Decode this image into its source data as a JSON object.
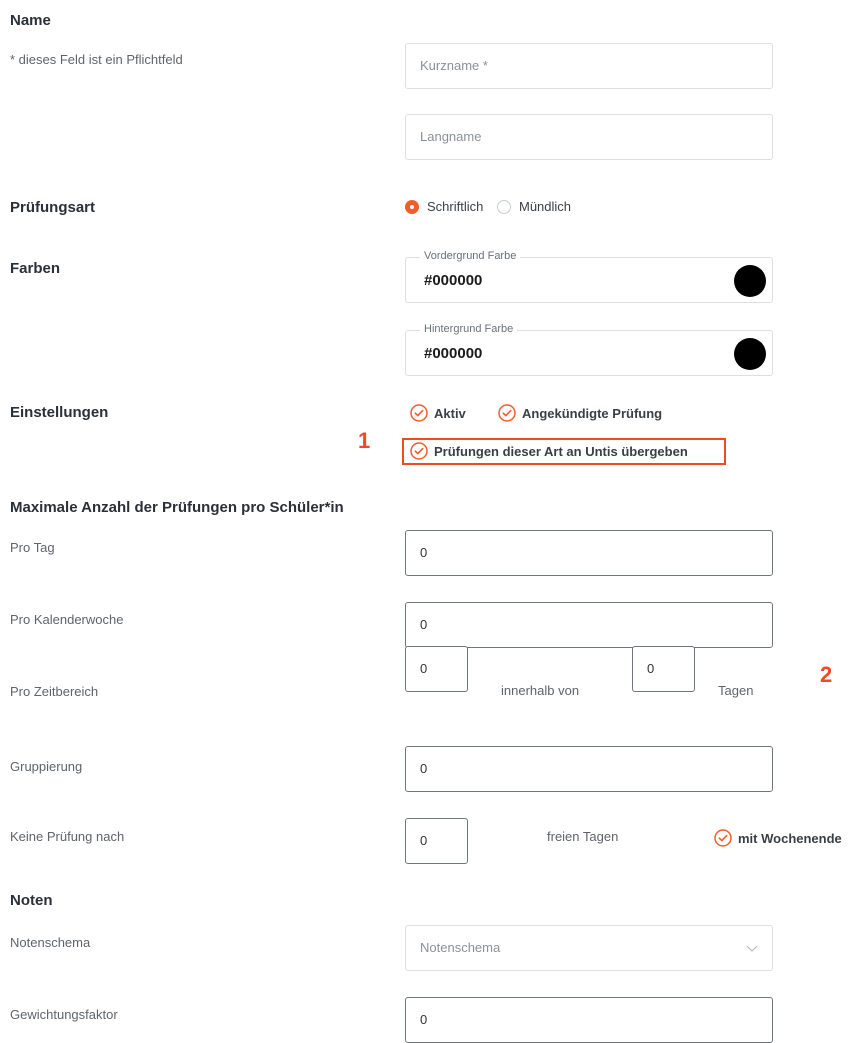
{
  "sections": {
    "name": "Name",
    "pruefungsart": "Prüfungsart",
    "farben": "Farben",
    "einstellungen": "Einstellungen",
    "maximale": "Maximale Anzahl der Prüfungen pro Schüler*in",
    "noten": "Noten"
  },
  "name": {
    "hint": "* dieses Feld ist ein Pflichtfeld",
    "kurzname_placeholder": "Kurzname *",
    "langname_placeholder": "Langname"
  },
  "pruefungsart": {
    "options": [
      "Schriftlich",
      "Mündlich"
    ],
    "selected": "Schriftlich"
  },
  "farben": {
    "vordergrund_label": "Vordergrund Farbe",
    "vordergrund_value": "#000000",
    "hintergrund_label": "Hintergrund Farbe",
    "hintergrund_value": "#000000",
    "swatch_color": "#000000"
  },
  "einstellungen": {
    "aktiv": "Aktiv",
    "angekuendigt": "Angekündigte Prüfung",
    "untis": "Prüfungen dieser Art an Untis übergeben"
  },
  "maximale": {
    "pro_tag_label": "Pro Tag",
    "pro_tag_value": "0",
    "pro_kw_label": "Pro Kalenderwoche",
    "pro_kw_value": "0",
    "pro_zeitbereich_label": "Pro Zeitbereich",
    "pro_zeitbereich_value": "0",
    "innerhalb_von": "innerhalb von",
    "tage_value": "0",
    "tagen": "Tagen",
    "gruppierung_label": "Gruppierung",
    "gruppierung_value": "0",
    "keine_pruefung_label": "Keine Prüfung nach",
    "keine_pruefung_value": "0",
    "freien_tagen": "freien Tagen",
    "mit_wochenende": "mit Wochenende"
  },
  "noten": {
    "notenschema_label": "Notenschema",
    "notenschema_placeholder": "Notenschema",
    "gewichtung_label": "Gewichtungsfaktor",
    "gewichtung_value": "0"
  },
  "annotations": {
    "marker_1": "1",
    "marker_2": "2"
  },
  "colors": {
    "accent": "#f25c2c",
    "annotation": "#f04a22"
  }
}
